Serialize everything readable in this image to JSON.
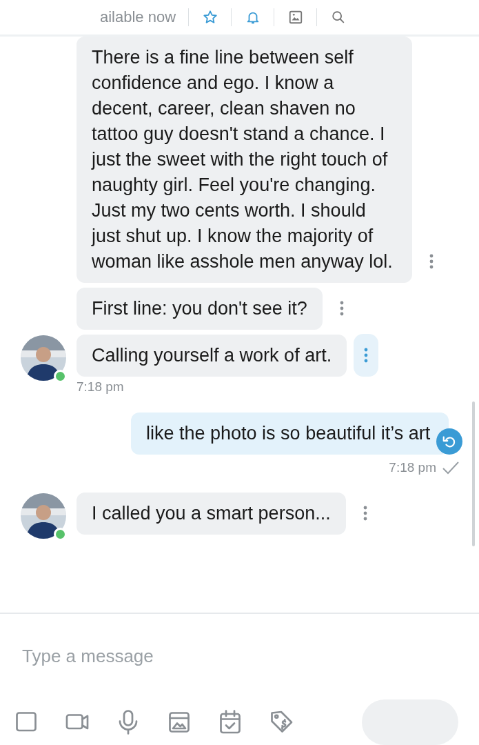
{
  "header": {
    "status": "ailable now",
    "actions": [
      {
        "kind": "star"
      },
      {
        "kind": "bell"
      },
      {
        "kind": "image"
      },
      {
        "kind": "search"
      }
    ]
  },
  "messages": [
    {
      "kind": "received",
      "text": "There is a fine line between self confidence and ego. I know a decent, career, clean shaven no tattoo guy doesn't stand a chance. I just the sweet with the right touch of naughty girl. Feel you're changing. Just my two cents worth. I should just shut up. I know the majority of woman like asshole men anyway lol.",
      "avatar": false,
      "menu_active": false
    },
    {
      "kind": "received",
      "text": "First line: you don't see it?",
      "avatar": false,
      "menu_active": false
    },
    {
      "kind": "received",
      "text": "Calling yourself a work of art.",
      "avatar": true,
      "online": true,
      "menu_active": true,
      "time": "7:18 pm"
    },
    {
      "kind": "sent",
      "text": "like the photo is so beautiful it’s art",
      "time": "7:18 pm",
      "read": true
    },
    {
      "kind": "received",
      "text": "I called you a smart person...",
      "avatar": true,
      "online": true,
      "menu_active": false
    }
  ],
  "composer": {
    "placeholder": "Type a message",
    "tools": [
      {
        "kind": "media"
      },
      {
        "kind": "video"
      },
      {
        "kind": "mic"
      },
      {
        "kind": "gallery"
      },
      {
        "kind": "calendar"
      },
      {
        "kind": "price"
      }
    ]
  }
}
